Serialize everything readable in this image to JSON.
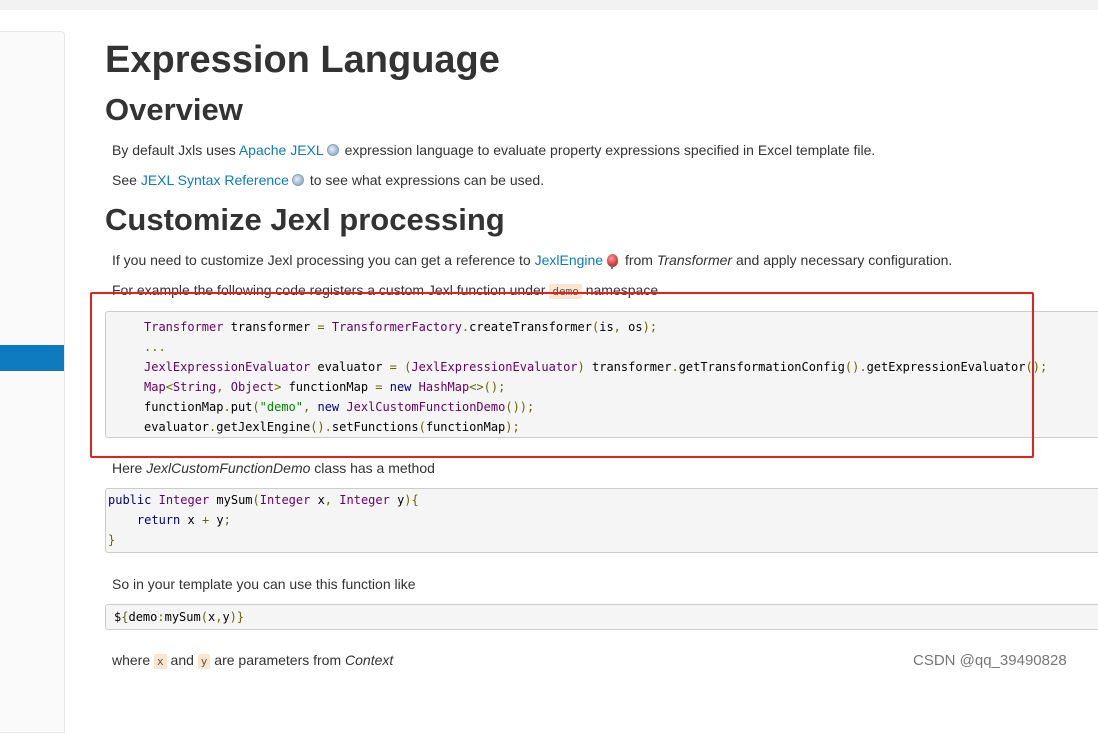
{
  "page": {
    "title": "Expression Language",
    "overview_heading": "Overview",
    "overview_p1": {
      "before": "By default Jxls uses ",
      "link": "Apache JEXL",
      "after": " expression language to evaluate property expressions specified in Excel template file."
    },
    "overview_p2": {
      "before": "See ",
      "link": "JEXL Syntax Reference",
      "after": " to see what expressions can be used."
    },
    "customize_heading": "Customize Jexl processing",
    "customize_p1": {
      "before": "If you need to customize Jexl processing you can get a reference to ",
      "link": "JexlEngine",
      "middle": " from ",
      "em": "Transformer",
      "after": " and apply necessary configuration."
    },
    "customize_p2": {
      "before": "For example the following code registers a custom Jexl function under ",
      "code": "demo",
      "after": " namespace"
    },
    "code1": [
      "Transformer transformer = TransformerFactory.createTransformer(is, os);",
      "...",
      "JexlExpressionEvaluator evaluator = (JexlExpressionEvaluator) transformer.getTransformationConfig().getExpressionEvaluator();",
      "Map<String, Object> functionMap = new HashMap<>();",
      "functionMap.put(\"demo\", new JexlCustomFunctionDemo());",
      "evaluator.getJexlEngine().setFunctions(functionMap);"
    ],
    "here_p": {
      "before": "Here ",
      "em": "JexlCustomFunctionDemo",
      "after": " class has a method"
    },
    "code2": [
      "public Integer mySum(Integer x, Integer y){",
      "    return x + y;",
      "}"
    ],
    "so_p": "So in your template you can use this function like",
    "code3": "${demo:mySum(x,y)}",
    "where_p": {
      "before": "where ",
      "code_x": "x",
      "and": " and ",
      "code_y": "y",
      "after": " are parameters from ",
      "em": "Context"
    }
  },
  "watermark": "CSDN @qq_39490828",
  "colors": {
    "link": "#0d7bbd",
    "sidebar_active": "#0d7bbd",
    "highlight_box": "#e2231a"
  },
  "icons": [
    "external-link-icon",
    "red-pin-icon"
  ]
}
